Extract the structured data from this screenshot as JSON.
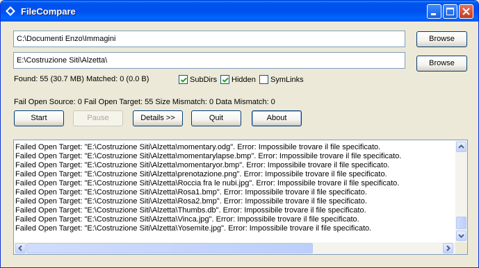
{
  "window": {
    "title": "FileCompare"
  },
  "paths": {
    "source": "C:\\Documenti Enzo\\Immagini",
    "target": "E:\\Costruzione Siti\\Alzetta\\"
  },
  "buttons": {
    "browse_source": "Browse",
    "browse_target": "Browse",
    "start": "Start",
    "pause": "Pause",
    "details": "Details >>",
    "quit": "Quit",
    "about": "About"
  },
  "stats": {
    "found_matched": "Found: 55 (30.7 MB)  Matched: 0 (0.0 B)",
    "errors": "Fail Open Source: 0  Fail Open Target: 55  Size Mismatch: 0  Data Mismatch: 0"
  },
  "options": {
    "subdirs": "SubDirs",
    "hidden": "Hidden",
    "symlinks": "SymLinks"
  },
  "log": [
    "Failed Open Target: \"E:\\Costruzione Siti\\Alzetta\\momentary.odg\".   Error: Impossibile trovare il file specificato.",
    "Failed Open Target: \"E:\\Costruzione Siti\\Alzetta\\momentarylapse.bmp\".   Error: Impossibile trovare il file specificato.",
    "Failed Open Target: \"E:\\Costruzione Siti\\Alzetta\\momentaryor.bmp\".   Error: Impossibile trovare il file specificato.",
    "Failed Open Target: \"E:\\Costruzione Siti\\Alzetta\\prenotazione.png\".   Error: Impossibile trovare il file specificato.",
    "Failed Open Target: \"E:\\Costruzione Siti\\Alzetta\\Roccia fra le nubi.jpg\".   Error: Impossibile trovare il file specificato.",
    "Failed Open Target: \"E:\\Costruzione Siti\\Alzetta\\Rosa1.bmp\".   Error: Impossibile trovare il file specificato.",
    "Failed Open Target: \"E:\\Costruzione Siti\\Alzetta\\Rosa2.bmp\".   Error: Impossibile trovare il file specificato.",
    "Failed Open Target: \"E:\\Costruzione Siti\\Alzetta\\Thumbs.db\".   Error: Impossibile trovare il file specificato.",
    "Failed Open Target: \"E:\\Costruzione Siti\\Alzetta\\Vinca.jpg\".   Error: Impossibile trovare il file specificato.",
    "Failed Open Target: \"E:\\Costruzione Siti\\Alzetta\\Yosemite.jpg\".   Error: Impossibile trovare il file specificato."
  ]
}
